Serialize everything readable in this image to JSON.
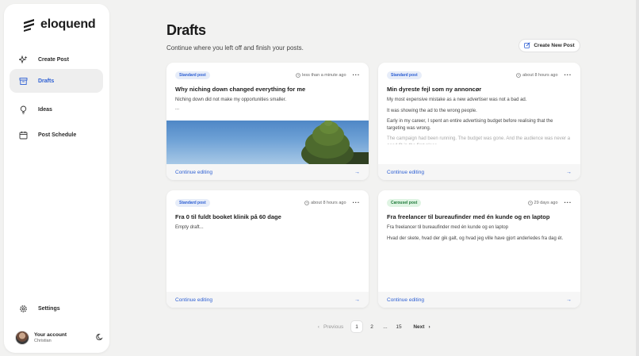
{
  "app": {
    "name": "eloquend",
    "accent": "#2d5fd3"
  },
  "sidebar": {
    "items": [
      {
        "label": "Create Post",
        "icon": "sparkles-icon"
      },
      {
        "label": "Drafts",
        "icon": "archive-icon",
        "active": true
      },
      {
        "label": "Ideas",
        "icon": "lightbulb-icon"
      },
      {
        "label": "Post Schedule",
        "icon": "calendar-icon"
      }
    ],
    "settings_label": "Settings",
    "account": {
      "name": "Your account",
      "user": "Christian"
    }
  },
  "main": {
    "title": "Drafts",
    "subtitle": "Continue where you left off and finish your posts.",
    "create_button": "Create New Post"
  },
  "cards": [
    {
      "badge": "Standard post",
      "time": "less than a minute ago",
      "title": "Why niching down changed everything for me",
      "lines": [
        "Niching down did not make my opportunities smaller.",
        "..."
      ],
      "has_image": true,
      "action": "Continue editing"
    },
    {
      "badge": "Standard post",
      "time": "about 8 hours ago",
      "title": "Min dyreste fejl som ny annoncør",
      "lines": [
        "My most expensive mistake as a new advertiser was not a bad ad.",
        "It was showing the ad to the wrong people.",
        "Early in my career, I spent an entire advertising budget before realising that the targeting was wrong.",
        "The campaign had been running. The budget was gone. And the audience was never a good fit in the first place."
      ],
      "action": "Continue editing"
    },
    {
      "badge": "Standard post",
      "time": "about 8 hours ago",
      "title": "Fra 0 til fuldt booket klinik på 60 dage",
      "lines": [
        "Empty draft..."
      ],
      "action": "Continue editing"
    },
    {
      "badge": "Carousel post",
      "time": "29 days ago",
      "title": "Fra freelancer til bureaufinder med én kunde og en laptop",
      "lines": [
        "Fra freelancer til bureaufinder med én kunde og en laptop",
        "Hvad der skete, hvad der gik galt, og hvad jeg ville have gjort anderledes fra dag ét."
      ],
      "action": "Continue editing"
    }
  ],
  "pagination": {
    "previous": "Previous",
    "pages": [
      "1",
      "2",
      "...",
      "15"
    ],
    "current": "1",
    "next": "Next"
  }
}
